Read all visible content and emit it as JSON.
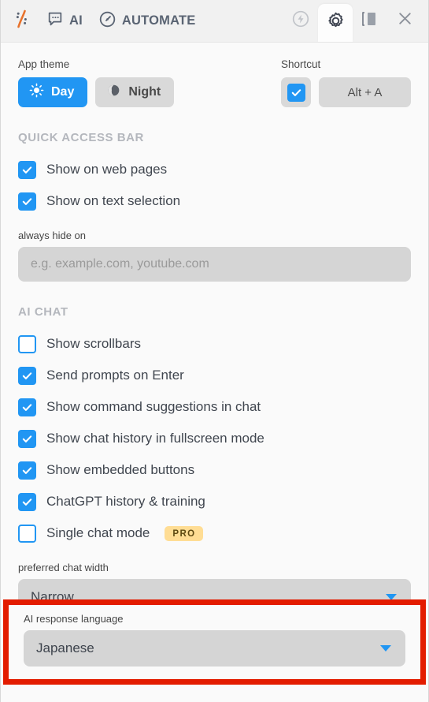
{
  "toolbar": {
    "logo_icon": "harpa-logo-icon",
    "items": [
      {
        "icon": "chat-bubble-icon",
        "label": "AI"
      },
      {
        "icon": "gauge-icon",
        "label": "AUTOMATE"
      }
    ],
    "right_icons": [
      {
        "icon": "lightning-bolt-circle-icon",
        "state": "dim"
      },
      {
        "icon": "gear-icon",
        "state": "active"
      },
      {
        "icon": "sidebar-panel-icon",
        "state": "normal"
      },
      {
        "icon": "close-icon",
        "state": "normal"
      }
    ]
  },
  "theme": {
    "label": "App theme",
    "options": [
      {
        "label": "Day",
        "icon": "sun-icon",
        "selected": true
      },
      {
        "label": "Night",
        "icon": "moon-icon",
        "selected": false
      }
    ]
  },
  "shortcut": {
    "label": "Shortcut",
    "enabled": true,
    "value": "Alt + A"
  },
  "quick_access": {
    "title": "QUICK ACCESS BAR",
    "options": [
      {
        "label": "Show on web pages",
        "checked": true
      },
      {
        "label": "Show on text selection",
        "checked": true
      }
    ],
    "hide_on": {
      "label": "always hide on",
      "value": "",
      "placeholder": "e.g. example.com, youtube.com"
    }
  },
  "ai_chat": {
    "title": "AI CHAT",
    "options": [
      {
        "label": "Show scrollbars",
        "checked": false
      },
      {
        "label": "Send prompts on Enter",
        "checked": true
      },
      {
        "label": "Show command suggestions in chat",
        "checked": true
      },
      {
        "label": "Show chat history in fullscreen mode",
        "checked": true
      },
      {
        "label": "Show embedded buttons",
        "checked": true
      },
      {
        "label": "ChatGPT history & training",
        "checked": true
      },
      {
        "label": "Single chat mode",
        "checked": false,
        "badge": "PRO"
      }
    ],
    "chat_width": {
      "label": "preferred chat width",
      "value": "Narrow"
    }
  },
  "response_language": {
    "label": "AI response language",
    "value": "Japanese",
    "highlighted": true
  },
  "colors": {
    "accent": "#2196f3",
    "highlight": "#e31c00",
    "pro_badge": "#ffdd94",
    "field": "#d5d5d5"
  }
}
